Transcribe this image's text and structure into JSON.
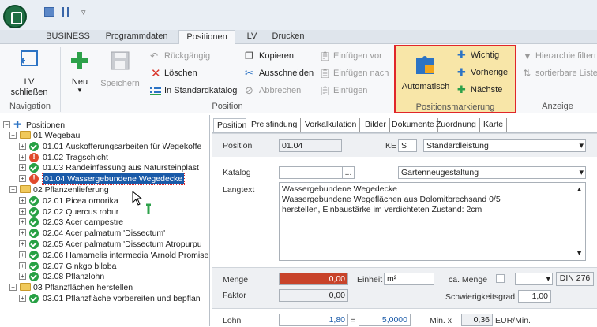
{
  "menu": {
    "tabs": [
      "BUSINESS",
      "Programmdaten",
      "Positionen",
      "LV",
      "Drucken"
    ],
    "active": "Positionen"
  },
  "ribbon": {
    "lv_close": "LV\nschließen",
    "lv_close_l1": "LV",
    "lv_close_l2": "schließen",
    "new": "Neu",
    "save": "Speichern",
    "undo": "Rückgängig",
    "delete": "Löschen",
    "to_catalog": "In Standardkatalog",
    "copy": "Kopieren",
    "cut": "Ausschneiden",
    "cancel": "Abbrechen",
    "paste_before": "Einfügen vor",
    "paste_after": "Einfügen nach",
    "paste": "Einfügen",
    "auto": "Automatisch",
    "important": "Wichtig",
    "previous": "Vorherige",
    "next": "Nächste",
    "hier_filter": "Hierarchie filtern",
    "sortable": "sortierbare Liste",
    "groups": {
      "navigation": "Navigation",
      "position": "Position",
      "marking": "Positionsmarkierung",
      "display": "Anzeige"
    }
  },
  "tree": {
    "root": "Positionen",
    "items": [
      {
        "level": 1,
        "label": "01 Wegebau",
        "type": "folder",
        "expanded": true
      },
      {
        "level": 2,
        "label": "01.01 Auskofferungsarbeiten für Wegekoffe",
        "type": "ok"
      },
      {
        "level": 2,
        "label": "01.02 Tragschicht",
        "type": "warn"
      },
      {
        "level": 2,
        "label": "01.03 Randeinfassung aus Natursteinplast",
        "type": "ok"
      },
      {
        "level": 2,
        "label": "01.04 Wassergebundene Wegedecke",
        "type": "warn",
        "selected": true
      },
      {
        "level": 1,
        "label": "02 Pflanzenlieferung",
        "type": "folder",
        "expanded": true
      },
      {
        "level": 2,
        "label": "02.01 Picea omorika",
        "type": "ok"
      },
      {
        "level": 2,
        "label": "02.02 Quercus robur",
        "type": "ok"
      },
      {
        "level": 2,
        "label": "02.03 Acer campestre",
        "type": "ok"
      },
      {
        "level": 2,
        "label": "02.04 Acer palmatum 'Dissectum'",
        "type": "ok"
      },
      {
        "level": 2,
        "label": "02.05 Acer palmatum 'Dissectum Atropurpu",
        "type": "ok"
      },
      {
        "level": 2,
        "label": "02.06 Hamamelis intermedia 'Arnold Promise",
        "type": "ok"
      },
      {
        "level": 2,
        "label": "02.07 Ginkgo biloba",
        "type": "ok"
      },
      {
        "level": 2,
        "label": "02.08 Pflanzlohn",
        "type": "ok"
      },
      {
        "level": 1,
        "label": "03 Pflanzflächen herstellen",
        "type": "folder",
        "expanded": true
      },
      {
        "level": 2,
        "label": "03.01 Pflanzfläche vorbereiten und bepflan",
        "type": "ok"
      }
    ]
  },
  "panel": {
    "tabs": [
      "Position",
      "Preisfindung",
      "Vorkalkulation",
      "Bilder",
      "Dokumente",
      "Zuordnung",
      "Karte"
    ],
    "active_tab": "Position",
    "position_label": "Position",
    "position_value": "01.04",
    "ke_label": "KE",
    "ke_value": "S",
    "ke_type": "Standardleistung",
    "katalog_label": "Katalog",
    "katalog_btn": "...",
    "katalog_value": "Gartenneugestaltung",
    "langtext_label": "Langtext",
    "langtext_lines": [
      "Wassergebundene Wegedecke",
      "Wassergebundene Wegeflächen aus Dolomitbrechsand 0/5",
      "herstellen, Einbaustärke im verdichteten Zustand: 2cm"
    ],
    "menge_label": "Menge",
    "menge_value": "0,00",
    "einheit_label": "Einheit",
    "einheit_value": "m²",
    "ca_menge_label": "ca. Menge",
    "din_btn": "DIN 276",
    "faktor_label": "Faktor",
    "faktor_value": "0,00",
    "schwierig_label": "Schwierigkeitsgrad",
    "schwierig_value": "1,00",
    "lohn_label": "Lohn",
    "lohn_value": "1,80",
    "lohn_eq": "=",
    "lohn_factor": "5,0000",
    "min_label": "Min. x",
    "min_value": "0,36",
    "eur_min": "EUR/Min."
  },
  "colors": {
    "accent": "#1a5aa8",
    "warning": "#e04a2c",
    "ok": "#27a044",
    "highlight_border": "#e0262a",
    "marking_bg": "#f8e6a8",
    "menge_bg": "#c8432a"
  }
}
